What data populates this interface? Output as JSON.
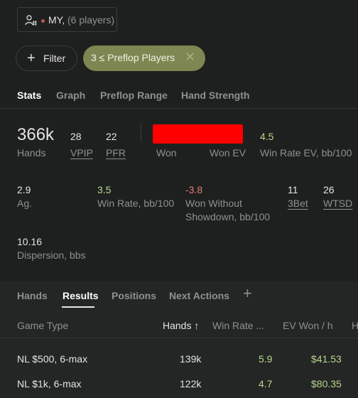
{
  "player_filter": {
    "name": "MY,",
    "count": "(6 players)"
  },
  "filters": {
    "filter_label": "Filter",
    "chip_label": "3 ≤ Preflop Players"
  },
  "tabs": [
    {
      "label": "Stats",
      "active": true
    },
    {
      "label": "Graph"
    },
    {
      "label": "Preflop Range"
    },
    {
      "label": "Hand Strength"
    }
  ],
  "stats": {
    "hands": {
      "value": "366k",
      "label": "Hands"
    },
    "vpip": {
      "value": "28",
      "label": "VPIP"
    },
    "pfr": {
      "value": "22",
      "label": "PFR"
    },
    "won": {
      "label": "Won"
    },
    "won_ev": {
      "label": "Won EV"
    },
    "win_rate_ev": {
      "value": "4.5",
      "label": "Win Rate EV, bb/100"
    },
    "ag": {
      "value": "2.9",
      "label": "Ag."
    },
    "win_rate": {
      "value": "3.5",
      "label": "Win Rate, bb/100"
    },
    "won_without_showdown": {
      "value": "-3.8",
      "label_line1": "Won Without",
      "label_line2": "Showdown, bb/100"
    },
    "three_bet": {
      "value": "11",
      "label": "3Bet"
    },
    "wtsd": {
      "value": "26",
      "label": "WTSD"
    },
    "dispersion": {
      "value": "10.16",
      "label": "Dispersion, bbs"
    }
  },
  "sub_tabs": [
    {
      "label": "Hands"
    },
    {
      "label": "Results",
      "active": true
    },
    {
      "label": "Positions"
    },
    {
      "label": "Next Actions"
    }
  ],
  "add_tab_symbol": "+",
  "table": {
    "headers": [
      "Game Type",
      "Hands ↑",
      "Win Rate ...",
      "EV Won / h",
      "H"
    ],
    "rows": [
      {
        "game": "NL $500, 6-max",
        "hands": "139k",
        "win_rate": "5.9",
        "ev_won": "$41.53"
      },
      {
        "game": "NL $1k, 6-max",
        "hands": "122k",
        "win_rate": "4.7",
        "ev_won": "$80.35"
      }
    ]
  },
  "colors": {
    "background": "#1e1f1f",
    "chip": "#7e8651",
    "positive": "#b6d98d",
    "negative": "#e07f76",
    "redaction": "#ff0000"
  }
}
